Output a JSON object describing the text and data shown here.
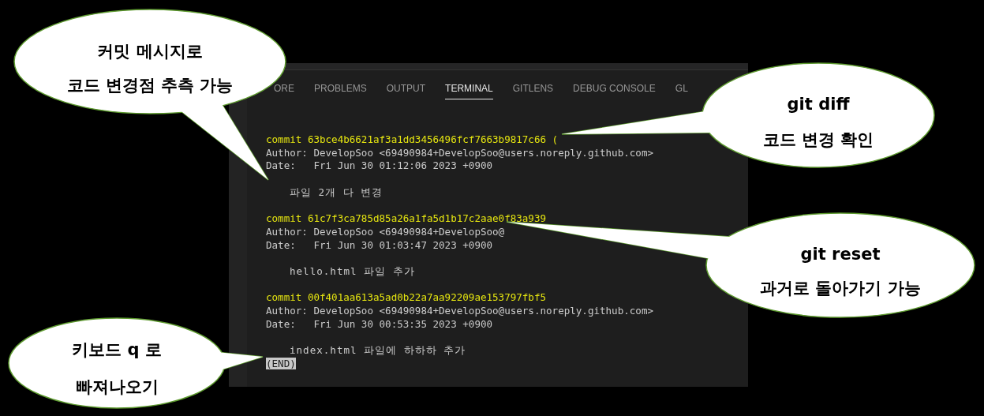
{
  "tabs": [
    {
      "label": "ORE",
      "selected": false
    },
    {
      "label": "PROBLEMS",
      "selected": false
    },
    {
      "label": "OUTPUT",
      "selected": false
    },
    {
      "label": "TERMINAL",
      "selected": true
    },
    {
      "label": "GITLENS",
      "selected": false
    },
    {
      "label": "DEBUG CONSOLE",
      "selected": false
    },
    {
      "label": "GL",
      "selected": false
    }
  ],
  "terminal_lines": [
    {
      "kind": "commit",
      "text": "commit 63bce4b6621af3a1dd3456496fcf7663b9817c66",
      "ref": "("
    },
    {
      "kind": "plain",
      "text": "Author: DevelopSoo <69490984+DevelopSoo@users.noreply.github.com>"
    },
    {
      "kind": "plain",
      "text": "Date:   Fri Jun 30 01:12:06 2023 +0900"
    },
    {
      "kind": "blank"
    },
    {
      "kind": "message",
      "text": "파일 2개 다 변경"
    },
    {
      "kind": "blank"
    },
    {
      "kind": "commit",
      "text": "commit 61c7f3ca785d85a26a1fa5d1b17c2aae0f83a939"
    },
    {
      "kind": "plain",
      "text": "Author: DevelopSoo <69490984+DevelopSoo@"
    },
    {
      "kind": "plain",
      "text": "Date:   Fri Jun 30 01:03:47 2023 +0900"
    },
    {
      "kind": "blank"
    },
    {
      "kind": "message",
      "text": "hello.html 파일 추가"
    },
    {
      "kind": "blank"
    },
    {
      "kind": "commit",
      "text": "commit 00f401aa613a5ad0b22a7aa92209ae153797fbf5"
    },
    {
      "kind": "plain",
      "text": "Author: DevelopSoo <69490984+DevelopSoo@users.noreply.github.com>"
    },
    {
      "kind": "plain",
      "text": "Date:   Fri Jun 30 00:53:35 2023 +0900"
    },
    {
      "kind": "blank"
    },
    {
      "kind": "message",
      "text": "index.html 파일에 하하하 추가"
    },
    {
      "kind": "end",
      "text": "(END)"
    }
  ],
  "callouts": [
    {
      "lines": [
        "커밋 메시지로",
        "코드 변경점 추측 가능"
      ]
    },
    {
      "lines": [
        "git diff",
        "코드 변경 확인"
      ]
    },
    {
      "lines": [
        "git reset",
        "과거로 돌아가기 가능"
      ]
    },
    {
      "lines": [
        "키보드 q 로",
        "빠져나오기"
      ]
    }
  ]
}
